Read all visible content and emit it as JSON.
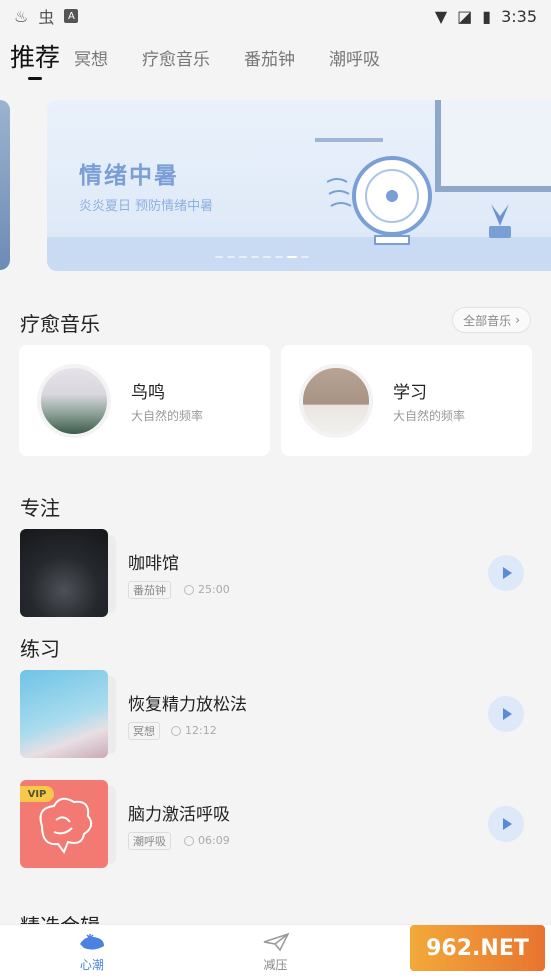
{
  "status_bar": {
    "time": "3:35"
  },
  "tabs": [
    "推荐",
    "冥想",
    "疗愈音乐",
    "番茄钟",
    "潮呼吸"
  ],
  "banner": {
    "title": "情绪中暑",
    "subtitle": "炎炎夏日 预防情绪中暑"
  },
  "healing_music": {
    "title": "疗愈音乐",
    "more": "全部音乐",
    "cards": [
      {
        "name": "鸟鸣",
        "desc": "大自然的频率"
      },
      {
        "name": "学习",
        "desc": "大自然的频率"
      }
    ]
  },
  "focus": {
    "title": "专注",
    "items": [
      {
        "title": "咖啡馆",
        "tag": "番茄钟",
        "duration": "25:00"
      }
    ]
  },
  "practice": {
    "title": "练习",
    "items": [
      {
        "title": "恢复精力放松法",
        "tag": "冥想",
        "duration": "12:12"
      },
      {
        "title": "脑力激活呼吸",
        "tag": "潮呼吸",
        "duration": "06:09",
        "badge": "VIP"
      }
    ]
  },
  "next_section_partial": "精选合辑",
  "bottom_nav": [
    "心潮",
    "减压"
  ],
  "watermark": "962.NET"
}
